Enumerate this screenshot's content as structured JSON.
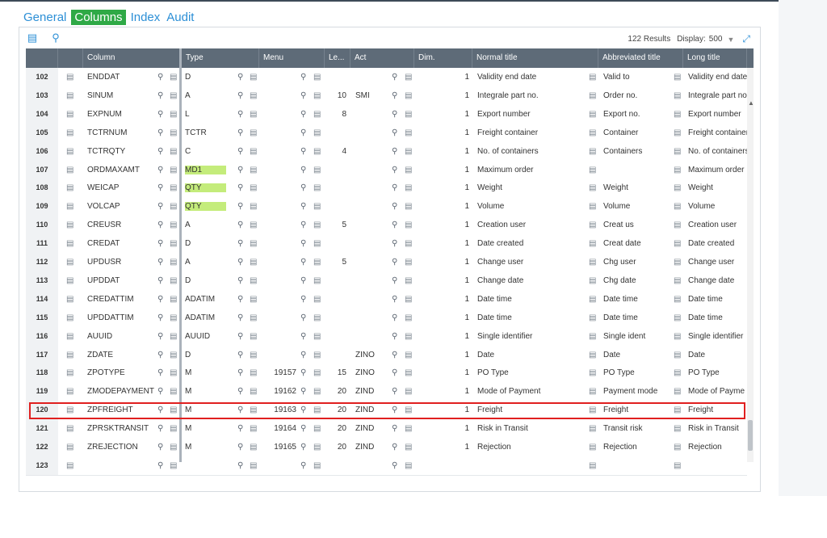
{
  "tabs": [
    {
      "label": "General",
      "active": false
    },
    {
      "label": "Columns",
      "active": true
    },
    {
      "label": "Index",
      "active": false
    },
    {
      "label": "Audit",
      "active": false
    }
  ],
  "toolbar": {
    "results_text": "122 Results",
    "display_label": "Display:",
    "display_value": "500"
  },
  "columns": [
    "",
    "",
    "Column",
    "Type",
    "Menu",
    "Le...",
    "Act",
    "Dim.",
    "Normal title",
    "Abbreviated title",
    "Long title"
  ],
  "rows": [
    {
      "num": "102",
      "column": "ENDDAT",
      "type": "D",
      "menu": "",
      "length": "",
      "act": "",
      "dim": "1",
      "normal": "Validity end date",
      "abbrev": "Valid to",
      "long": "Validity end date",
      "hl": false
    },
    {
      "num": "103",
      "column": "SINUM",
      "type": "A",
      "menu": "",
      "length": "10",
      "act": "SMI",
      "dim": "1",
      "normal": "Integrale part no.",
      "abbrev": "Order no.",
      "long": "Integrale part no",
      "hl": false
    },
    {
      "num": "104",
      "column": "EXPNUM",
      "type": "L",
      "menu": "",
      "length": "8",
      "act": "",
      "dim": "1",
      "normal": "Export number",
      "abbrev": "Export no.",
      "long": "Export number",
      "hl": false
    },
    {
      "num": "105",
      "column": "TCTRNUM",
      "type": "TCTR",
      "menu": "",
      "length": "",
      "act": "",
      "dim": "1",
      "normal": "Freight container",
      "abbrev": "Container",
      "long": "Freight container",
      "hl": false
    },
    {
      "num": "106",
      "column": "TCTRQTY",
      "type": "C",
      "menu": "",
      "length": "4",
      "act": "",
      "dim": "1",
      "normal": "No. of containers",
      "abbrev": "Containers",
      "long": "No. of containers",
      "hl": false
    },
    {
      "num": "107",
      "column": "ORDMAXAMT",
      "type": "MD1",
      "menu": "",
      "length": "",
      "act": "",
      "dim": "1",
      "normal": "Maximum order",
      "abbrev": "",
      "long": "Maximum order",
      "hl": true
    },
    {
      "num": "108",
      "column": "WEICAP",
      "type": "QTY",
      "menu": "",
      "length": "",
      "act": "",
      "dim": "1",
      "normal": "Weight",
      "abbrev": "Weight",
      "long": "Weight",
      "hl": true
    },
    {
      "num": "109",
      "column": "VOLCAP",
      "type": "QTY",
      "menu": "",
      "length": "",
      "act": "",
      "dim": "1",
      "normal": "Volume",
      "abbrev": "Volume",
      "long": "Volume",
      "hl": true
    },
    {
      "num": "110",
      "column": "CREUSR",
      "type": "A",
      "menu": "",
      "length": "5",
      "act": "",
      "dim": "1",
      "normal": "Creation user",
      "abbrev": "Creat us",
      "long": "Creation user",
      "hl": false
    },
    {
      "num": "111",
      "column": "CREDAT",
      "type": "D",
      "menu": "",
      "length": "",
      "act": "",
      "dim": "1",
      "normal": "Date created",
      "abbrev": "Creat date",
      "long": "Date created",
      "hl": false
    },
    {
      "num": "112",
      "column": "UPDUSR",
      "type": "A",
      "menu": "",
      "length": "5",
      "act": "",
      "dim": "1",
      "normal": "Change user",
      "abbrev": "Chg user",
      "long": "Change user",
      "hl": false
    },
    {
      "num": "113",
      "column": "UPDDAT",
      "type": "D",
      "menu": "",
      "length": "",
      "act": "",
      "dim": "1",
      "normal": "Change date",
      "abbrev": "Chg date",
      "long": "Change date",
      "hl": false
    },
    {
      "num": "114",
      "column": "CREDATTIM",
      "type": "ADATIM",
      "menu": "",
      "length": "",
      "act": "",
      "dim": "1",
      "normal": "Date time",
      "abbrev": "Date time",
      "long": "Date time",
      "hl": false
    },
    {
      "num": "115",
      "column": "UPDDATTIM",
      "type": "ADATIM",
      "menu": "",
      "length": "",
      "act": "",
      "dim": "1",
      "normal": "Date time",
      "abbrev": "Date time",
      "long": "Date time",
      "hl": false
    },
    {
      "num": "116",
      "column": "AUUID",
      "type": "AUUID",
      "menu": "",
      "length": "",
      "act": "",
      "dim": "1",
      "normal": "Single identifier",
      "abbrev": "Single ident",
      "long": "Single identifier",
      "hl": false
    },
    {
      "num": "117",
      "column": "ZDATE",
      "type": "D",
      "menu": "",
      "length": "",
      "act": "ZINO",
      "dim": "1",
      "normal": "Date",
      "abbrev": "Date",
      "long": "Date",
      "hl": false
    },
    {
      "num": "118",
      "column": "ZPOTYPE",
      "type": "M",
      "menu": "19157",
      "length": "15",
      "act": "ZINO",
      "dim": "1",
      "normal": "PO Type",
      "abbrev": "PO Type",
      "long": "PO Type",
      "hl": false
    },
    {
      "num": "119",
      "column": "ZMODEPAYMENT",
      "type": "M",
      "menu": "19162",
      "length": "20",
      "act": "ZIND",
      "dim": "1",
      "normal": "Mode of Payment",
      "abbrev": "Payment mode",
      "long": "Mode of Payme",
      "hl": false
    },
    {
      "num": "120",
      "column": "ZPFREIGHT",
      "type": "M",
      "menu": "19163",
      "length": "20",
      "act": "ZIND",
      "dim": "1",
      "normal": "Freight",
      "abbrev": "Freight",
      "long": "Freight",
      "hl": false
    },
    {
      "num": "121",
      "column": "ZPRSKTRANSIT",
      "type": "M",
      "menu": "19164",
      "length": "20",
      "act": "ZIND",
      "dim": "1",
      "normal": "Risk in Transit",
      "abbrev": "Transit risk",
      "long": "Risk in Transit",
      "hl": false
    },
    {
      "num": "122",
      "column": "ZREJECTION",
      "type": "M",
      "menu": "19165",
      "length": "20",
      "act": "ZIND",
      "dim": "1",
      "normal": "Rejection",
      "abbrev": "Rejection",
      "long": "Rejection",
      "hl": false
    },
    {
      "num": "123",
      "column": "",
      "type": "",
      "menu": "",
      "length": "",
      "act": "",
      "dim": "",
      "normal": "",
      "abbrev": "",
      "long": "",
      "hl": false
    }
  ],
  "icons": {
    "detail": "detail-icon",
    "search": "search-icon",
    "expand": "expand-icon"
  },
  "colors": {
    "active_tab": "#2fa946",
    "highlight_cell": "#c4ec7b",
    "selection_border": "#e02020",
    "header_bg": "#5e6b78"
  }
}
